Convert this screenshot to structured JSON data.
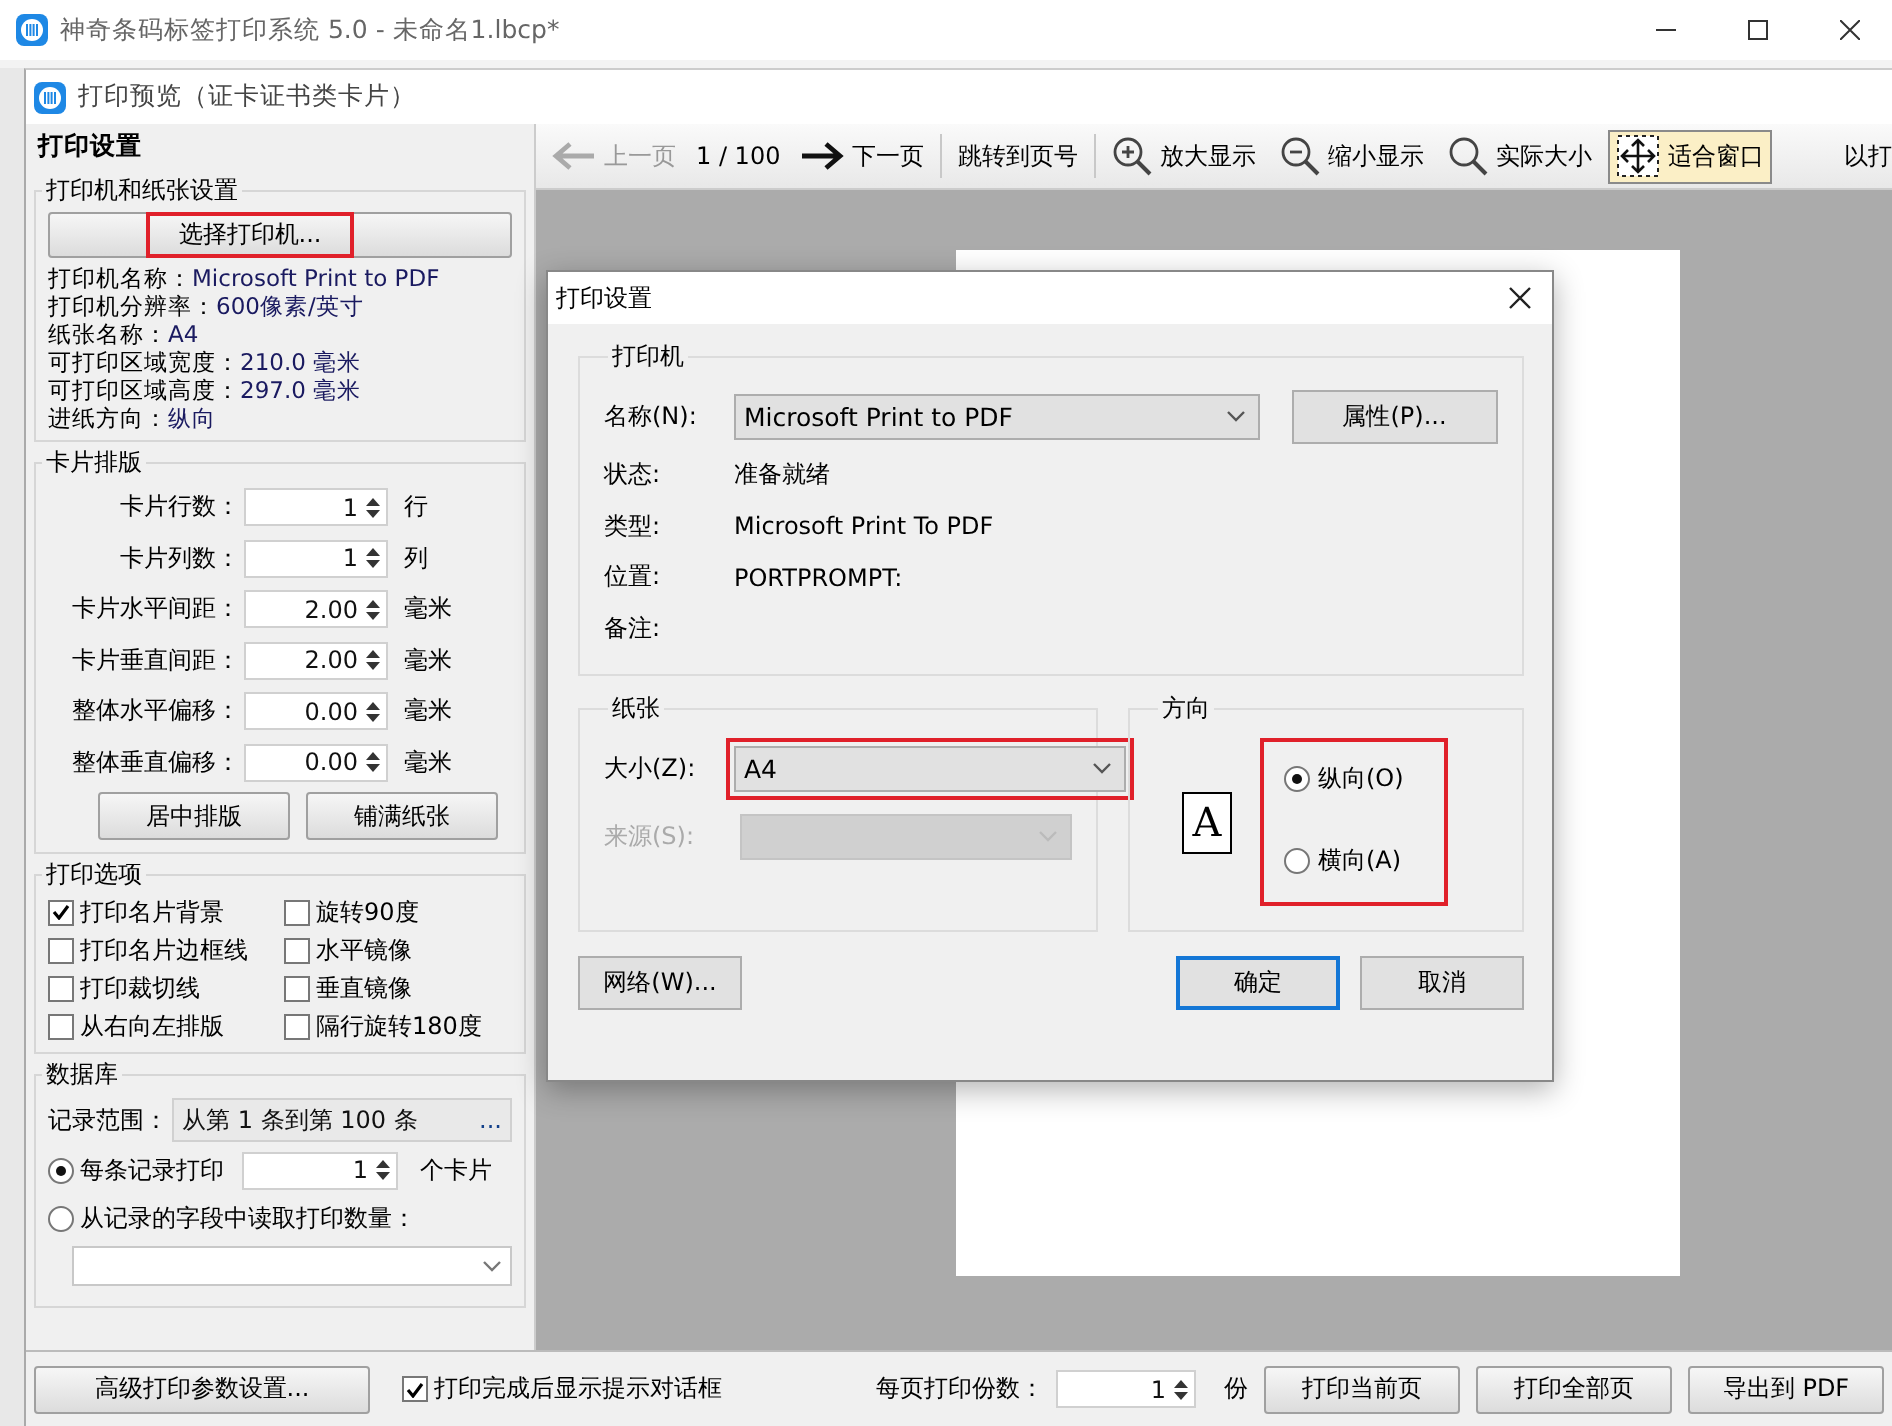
{
  "app": {
    "title": "神奇条码标签打印系统 5.0 - 未命名1.lbcp*"
  },
  "preview_window": {
    "title": "打印预览（证卡证书类卡片）"
  },
  "settings_panel": {
    "title": "打印设置",
    "printer_group": {
      "title": "打印机和纸张设置",
      "select_button": {
        "label": "选择打印机...",
        "highlighted": true
      },
      "info": [
        {
          "label": "打印机名称：",
          "value": "Microsoft Print to PDF"
        },
        {
          "label": "打印机分辨率：",
          "value": "600像素/英寸"
        },
        {
          "label": "纸张名称：",
          "value": "A4"
        },
        {
          "label": "可打印区域宽度：",
          "value": "210.0 毫米"
        },
        {
          "label": "可打印区域高度：",
          "value": "297.0 毫米"
        },
        {
          "label": "进纸方向：",
          "value": "纵向"
        }
      ]
    },
    "layout_group": {
      "title": "卡片排版",
      "fields": [
        {
          "label": "卡片行数：",
          "value": "1",
          "unit": "行"
        },
        {
          "label": "卡片列数：",
          "value": "1",
          "unit": "列"
        },
        {
          "label": "卡片水平间距：",
          "value": "2.00",
          "unit": "毫米"
        },
        {
          "label": "卡片垂直间距：",
          "value": "2.00",
          "unit": "毫米"
        },
        {
          "label": "整体水平偏移：",
          "value": "0.00",
          "unit": "毫米"
        },
        {
          "label": "整体垂直偏移：",
          "value": "0.00",
          "unit": "毫米"
        }
      ],
      "buttons": [
        "居中排版",
        "铺满纸张"
      ]
    },
    "options_group": {
      "title": "打印选项",
      "options": [
        {
          "label": "打印名片背景",
          "checked": true
        },
        {
          "label": "旋转90度",
          "checked": false
        },
        {
          "label": "打印名片边框线",
          "checked": false
        },
        {
          "label": "水平镜像",
          "checked": false
        },
        {
          "label": "打印裁切线",
          "checked": false
        },
        {
          "label": "垂直镜像",
          "checked": false
        },
        {
          "label": "从右向左排版",
          "checked": false
        },
        {
          "label": "隔行旋转180度",
          "checked": false
        }
      ]
    },
    "database_group": {
      "title": "数据库",
      "range_label": "记录范围：",
      "range_value": "从第 1 条到第 100 条",
      "range_button": "...",
      "modes": [
        {
          "kind": "spin",
          "label": "每条记录打印",
          "selected": true,
          "value": "1",
          "unit": "个卡片"
        },
        {
          "kind": "dropdown",
          "label": "从记录的字段中读取打印数量：",
          "selected": false
        }
      ]
    }
  },
  "toolbar": {
    "items": [
      {
        "kind": "prev",
        "label": "上一页",
        "disabled": true,
        "selected": false
      },
      {
        "kind": "page",
        "label": "1 / 100"
      },
      {
        "kind": "next",
        "label": "下一页",
        "disabled": false,
        "selected": false
      },
      {
        "kind": "jump",
        "label": "跳转到页号",
        "disabled": false,
        "selected": false
      },
      {
        "kind": "zoomin",
        "label": "放大显示",
        "disabled": false,
        "selected": false
      },
      {
        "kind": "zoomout",
        "label": "缩小显示",
        "disabled": false,
        "selected": false
      },
      {
        "kind": "actual",
        "label": "实际大小",
        "disabled": false,
        "selected": false
      },
      {
        "kind": "fit",
        "label": "适合窗口",
        "disabled": false,
        "selected": true
      },
      {
        "kind": "cut",
        "label": "以打"
      }
    ]
  },
  "bottom_bar": {
    "advanced_button": "高级打印参数设置...",
    "show_prompt": {
      "label": "打印完成后显示提示对话框",
      "checked": true
    },
    "copies": {
      "label": "每页打印份数：",
      "value": "1",
      "unit": "份"
    },
    "buttons": [
      "打印当前页",
      "打印全部页",
      "导出到 PDF"
    ]
  },
  "dialog": {
    "title": "打印设置",
    "printer": {
      "title": "打印机",
      "name_label": "名称(N):",
      "name_value": "Microsoft Print to PDF",
      "properties_button": "属性(P)...",
      "details": [
        {
          "label": "状态:",
          "value": "准备就绪"
        },
        {
          "label": "类型:",
          "value": "Microsoft Print To PDF"
        },
        {
          "label": "位置:",
          "value": "PORTPROMPT:"
        },
        {
          "label": "备注:"
        }
      ]
    },
    "paper": {
      "title": "纸张",
      "size": {
        "label": "大小(Z):",
        "value": "A4",
        "highlighted": true
      },
      "source": {
        "label": "来源(S):",
        "disabled": true
      }
    },
    "orientation": {
      "title": "方向",
      "preview_glyph": "A",
      "highlighted": true,
      "options": [
        {
          "label": "纵向(O)",
          "selected": true
        },
        {
          "label": "横向(A)",
          "selected": false
        }
      ]
    },
    "network_button": "网络(W)...",
    "ok_button": {
      "label": "确定",
      "default": true
    },
    "cancel_button": "取消"
  }
}
